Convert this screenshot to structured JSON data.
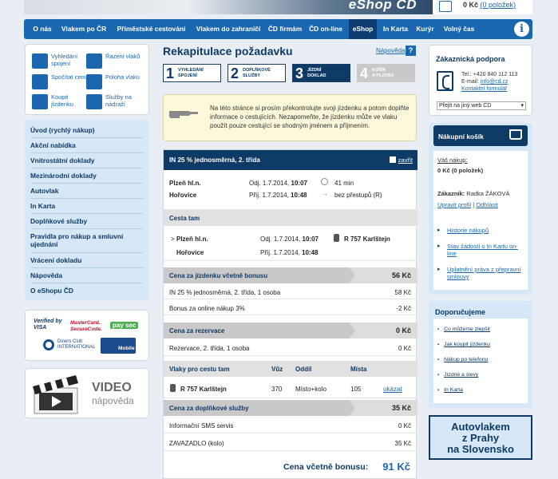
{
  "header": {
    "title": "eShop ČD",
    "cart_price": "0 Kč",
    "cart_items": "(0 položek)"
  },
  "nav": {
    "items": [
      "O nás",
      "Vlakem po ČR",
      "Příměstské cestování",
      "Vlakem do zahraničí",
      "ČD firmám",
      "ČD on-line",
      "eShop",
      "In Karta",
      "Kurýr",
      "Volný čas"
    ],
    "active": "eShop",
    "info_icon": "i"
  },
  "quick_links": [
    {
      "label": "Vyhledání spojení",
      "icon": "search-connection-icon"
    },
    {
      "label": "Řazení vlaků",
      "icon": "train-composition-icon"
    },
    {
      "label": "Spočítat cenu",
      "icon": "price-calculator-icon"
    },
    {
      "label": "Poloha vlaku",
      "icon": "train-position-icon"
    },
    {
      "label": "Koupit jízdenku",
      "icon": "buy-ticket-icon"
    },
    {
      "label": "Služby na nádraží",
      "icon": "station-services-icon"
    }
  ],
  "left_menu": [
    "Úvod (rychlý nákup)",
    "Akční nabídka",
    "Vnitrostátní doklady",
    "Mezinárodní doklady",
    "Autovlak",
    "In Karta",
    "Doplňkové služby",
    "Pravidla pro nákup a smluvní ujednání",
    "Vrácení dokladu",
    "Nápověda",
    "O eShopu ČD"
  ],
  "payments": {
    "verified_visa": "Verified by VISA",
    "mastercard": "MasterCard. SecureCode.",
    "paysec": "pay sec",
    "diners": "Diners Club INTERNATIONAL",
    "mobile": "Mobile"
  },
  "video": {
    "title": "VIDEO",
    "subtitle": "nápověda"
  },
  "page": {
    "title": "Rekapitulace požadavku",
    "help": "Nápověda",
    "help_icon": "?"
  },
  "steps": [
    {
      "num": "1",
      "label1": "VYHLEDÁNÍ",
      "label2": "SPOJENÍ",
      "state": "done"
    },
    {
      "num": "2",
      "label1": "DOPLŇKOVÉ",
      "label2": "SLUŽBY",
      "state": "done"
    },
    {
      "num": "3",
      "label1": "JÍZDNÍ",
      "label2": "DOKLAD",
      "state": "active"
    },
    {
      "num": "4",
      "label1": "KOŠÍK",
      "label2": "A PLATBA",
      "state": "disabled"
    }
  ],
  "notice": "Na této stránce si prosím překontrolujte svoji jízdenku a potom doplňte informace o cestujících. Nezapomeňte, že jízdenku může ve vlaku použít pouze cestující se shodným jménem a příjmením.",
  "ticket": {
    "header": "IN 25 % jednosměrná, 2. třída",
    "close": "zavřít",
    "from": "Plzeň hl.n.",
    "to": "Hořovice",
    "dep_label": "Odj. 1.7.2014,",
    "dep_time": "10:07",
    "arr_label": "Příj. 1.7.2014,",
    "arr_time": "10:48",
    "duration": "41 min",
    "transfers": "bez přestupů (R)",
    "journey_title": "Cesta tam",
    "journey": {
      "marker": ">",
      "from": "Plzeň hl.n.",
      "to": "Hořovice",
      "dep_label": "Odj. 1.7.2014,",
      "dep_time": "10:07",
      "arr_label": "Příj. 1.7.2014,",
      "arr_time": "10:48",
      "train": "R 757 Karlštejn"
    },
    "price_ticket": {
      "label": "Cena za jízdenku včetně bonusu",
      "amount": "56 Kč",
      "items": [
        {
          "label": "IN 25 % jednosměrná, 2. třída, 1 osoba",
          "amount": "58 Kč"
        },
        {
          "label": "Bonus za online nákup 3%",
          "amount": "-2 Kč"
        }
      ]
    },
    "price_reservation": {
      "label": "Cena za rezervace",
      "amount": "0 Kč",
      "items": [
        {
          "label": "Rezervace, 2. třída, 1 osoba",
          "amount": "0 Kč"
        }
      ]
    },
    "trains_table": {
      "headers": [
        "Vlaky pro cestu tam",
        "Vůz",
        "Oddíl",
        "Místa"
      ],
      "row": {
        "train": "R 757 Karlštejn",
        "car": "370",
        "section": "Místo+kolo",
        "seats": "105",
        "action": "ukázat"
      }
    },
    "price_services": {
      "label": "Cena za doplňkové služby",
      "amount": "35 Kč",
      "items": [
        {
          "label": "Informační SMS servis",
          "amount": "0 Kč"
        },
        {
          "label": "ZAVAZADLO (kolo)",
          "amount": "35 Kč"
        }
      ]
    },
    "total_label": "Cena včetně bonusu:",
    "total_amount": "91 Kč"
  },
  "support": {
    "title": "Zákaznická podpora",
    "tel": "Tel.: +420 840 112 113",
    "email_label": "E-mail:",
    "email": "info@cd.cz",
    "form": "Kontaktní formulář",
    "select": "Přejít na jiný web ČD"
  },
  "cart": {
    "title": "Nákupní košík",
    "your_purchase": "Váš nákup:",
    "summary": "0 Kč (0 položek)",
    "customer_label": "Zákazník:",
    "customer_name": "Radka ŽÁKOVÁ",
    "edit_profile": "Upravit profil",
    "separator": "|",
    "logout": "Odhlásit",
    "links": [
      "Historie nákupů",
      "Stav žádostí o In Kartu on-line",
      "Uplatnění práva z přepravní smlouvy"
    ]
  },
  "recommend": {
    "title": "Doporučujeme",
    "links": [
      "Co můžeme zlepšit",
      "Jak koupit jízdenku",
      "Nákup po telefonu",
      "Jízdné a slevy",
      "In Karta"
    ]
  },
  "promo": {
    "line1": "Autovlakem",
    "line2": "z Prahy",
    "line3": "na Slovensko"
  }
}
